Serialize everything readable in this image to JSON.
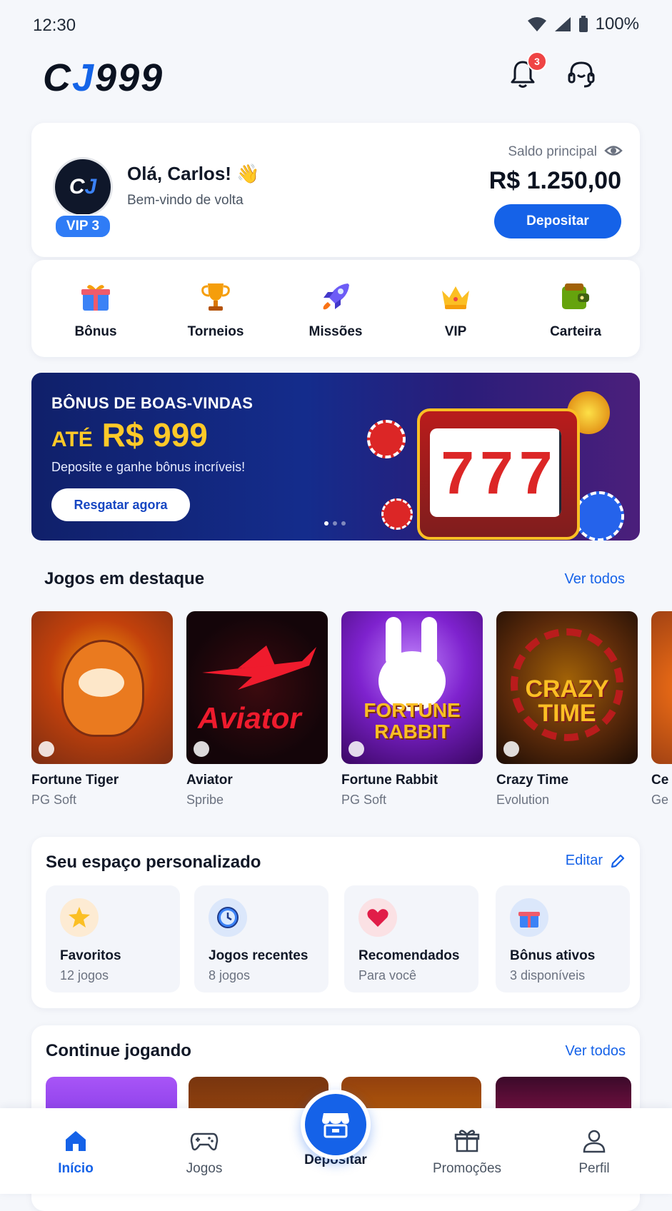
{
  "status_bar": {
    "time": "12:30",
    "battery": "100%"
  },
  "header": {
    "logo": "CJ999",
    "notifications_count": "3"
  },
  "profile": {
    "avatar_text": "CJ",
    "vip": "VIP 3",
    "greeting": "Olá, Carlos! 👋",
    "welcome": "Bem-vindo de volta",
    "balance_label": "Saldo principal",
    "balance": "R$ 1.250,00",
    "deposit_button": "Depositar"
  },
  "quick_actions": [
    {
      "label": "Bônus",
      "icon": "gift-icon"
    },
    {
      "label": "Torneios",
      "icon": "trophy-icon"
    },
    {
      "label": "Missões",
      "icon": "rocket-icon"
    },
    {
      "label": "VIP",
      "icon": "crown-icon"
    },
    {
      "label": "Carteira",
      "icon": "wallet-icon"
    }
  ],
  "banner": {
    "line1": "BÔNUS DE BOAS-VINDAS",
    "prefix": "ATÉ",
    "amount": "R$ 999",
    "subtitle": "Deposite e ganhe bônus incríveis!",
    "button": "Resgatar agora",
    "reel": "777"
  },
  "featured": {
    "title": "Jogos em destaque",
    "see_all": "Ver todos",
    "games": [
      {
        "name": "Fortune Tiger",
        "provider": "PG Soft",
        "art": ""
      },
      {
        "name": "Aviator",
        "provider": "Spribe",
        "art": "Aviator"
      },
      {
        "name": "Fortune Rabbit",
        "provider": "PG Soft",
        "art": "FORTUNE RABBIT"
      },
      {
        "name": "Crazy Time",
        "provider": "Evolution",
        "art": "CRAZY TIME"
      },
      {
        "name": "Ce",
        "provider": "Ge",
        "art": ""
      }
    ]
  },
  "personal": {
    "title": "Seu espaço personalizado",
    "edit": "Editar",
    "tiles": [
      {
        "title": "Favoritos",
        "sub": "12 jogos",
        "icon": "star-icon"
      },
      {
        "title": "Jogos recentes",
        "sub": "8 jogos",
        "icon": "clock-icon"
      },
      {
        "title": "Recomendados",
        "sub": "Para você",
        "icon": "heart-icon"
      },
      {
        "title": "Bônus ativos",
        "sub": "3 disponíveis",
        "icon": "gift-icon"
      }
    ]
  },
  "continue": {
    "title": "Continue jogando",
    "see_all": "Ver todos"
  },
  "nav": [
    {
      "label": "Início",
      "active": true
    },
    {
      "label": "Jogos"
    },
    {
      "label": "Depositar"
    },
    {
      "label": "Promoções"
    },
    {
      "label": "Perfil"
    }
  ],
  "colors": {
    "primary": "#1562e8",
    "banner_gold": "#ffc928",
    "badge_red": "#ef4444"
  }
}
